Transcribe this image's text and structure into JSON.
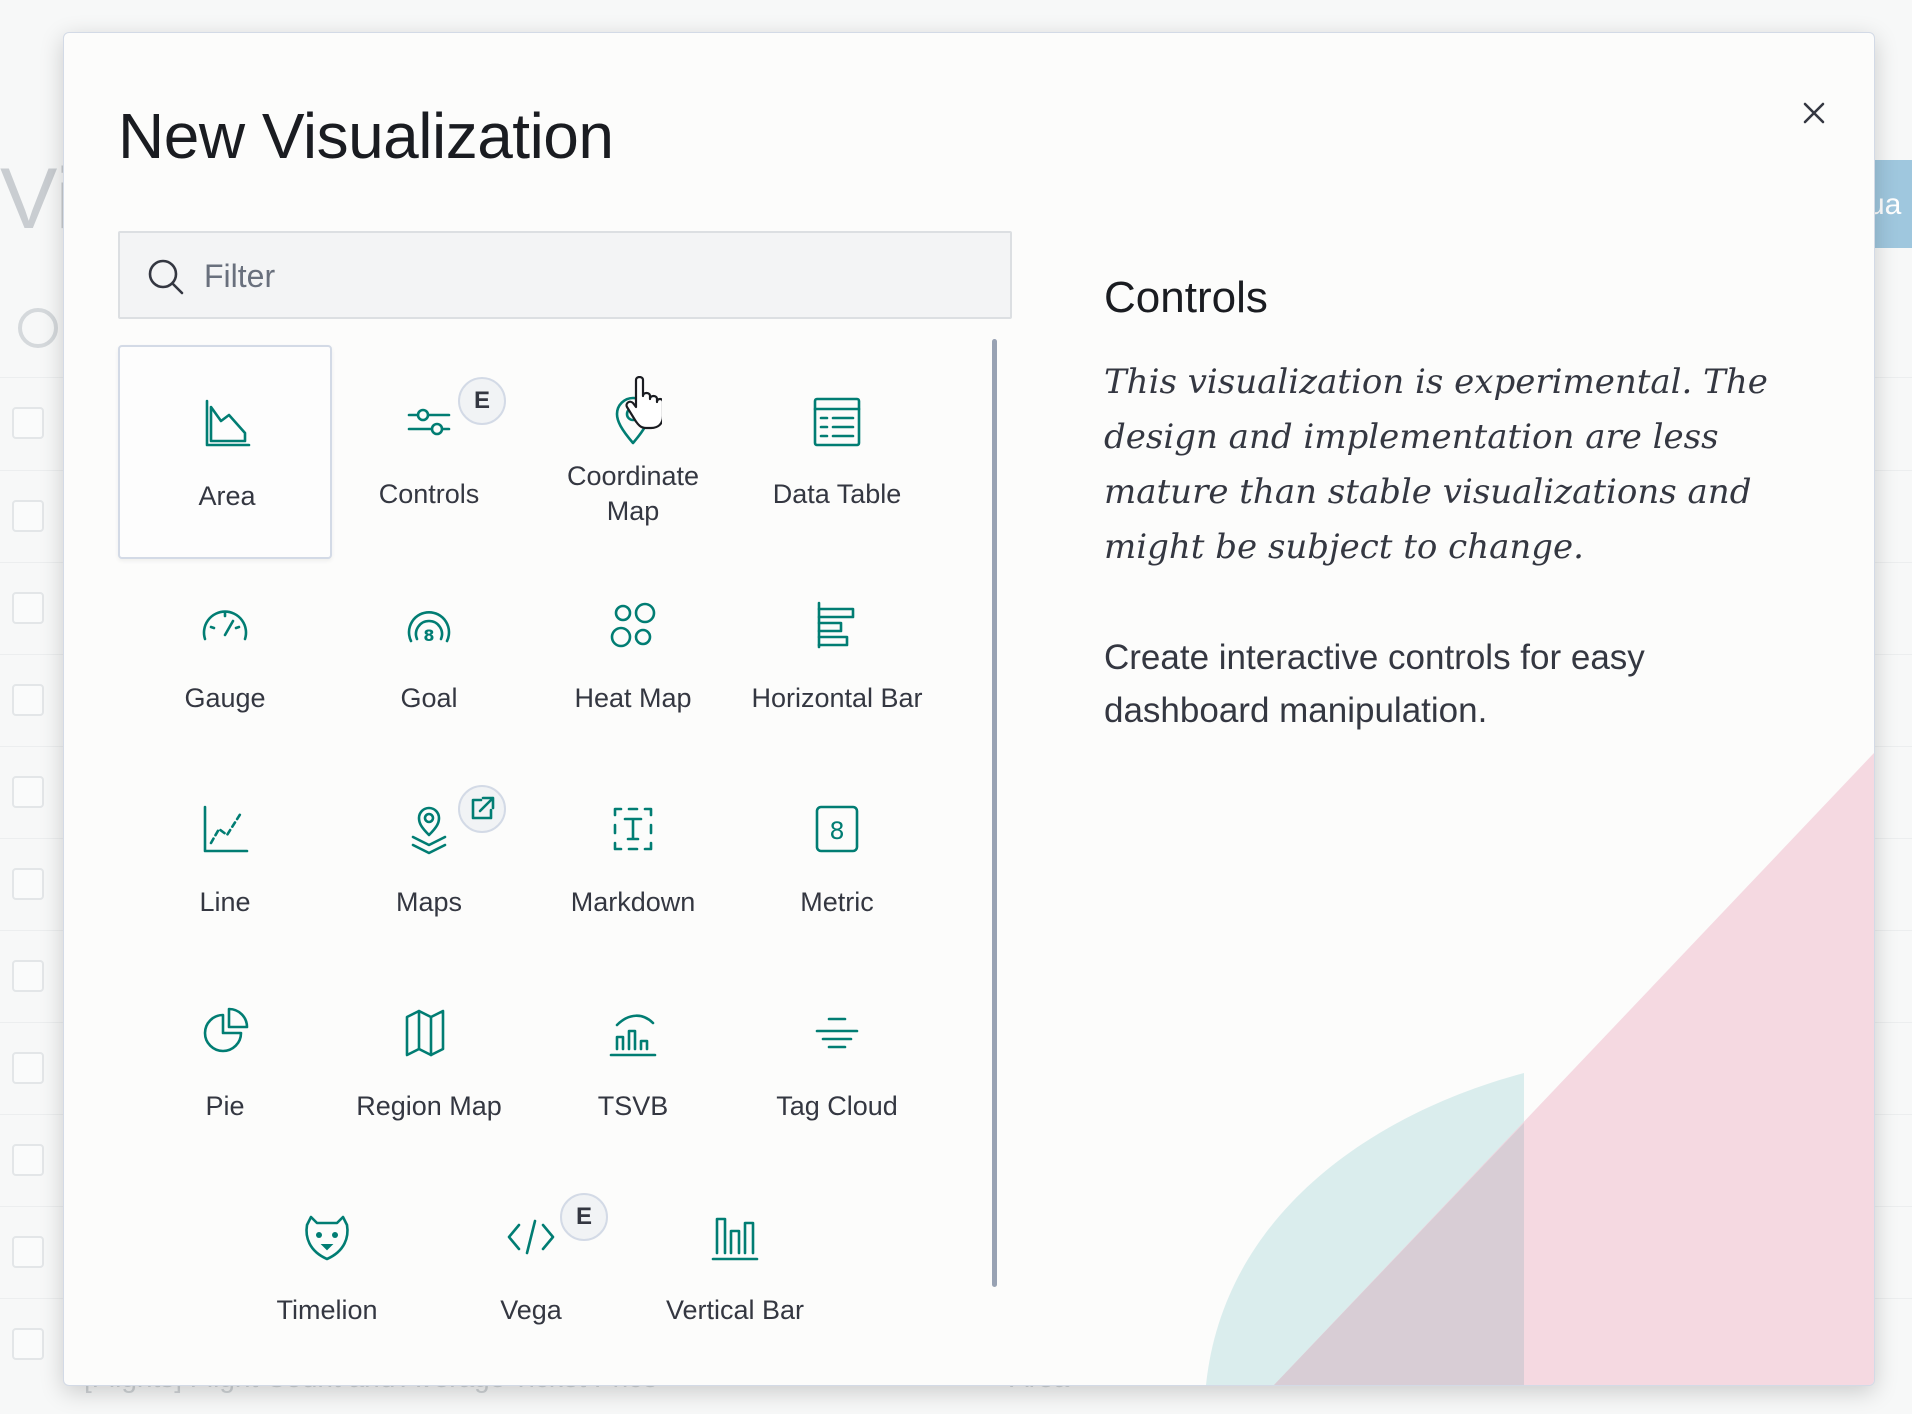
{
  "background": {
    "page_title": "Vi",
    "button_text": "ua",
    "bottom_row_text": "[Flights] Flight Count and Average Ticket Price",
    "bottom_row_type": "Area"
  },
  "modal": {
    "title": "New Visualization",
    "close_label": "×",
    "filter": {
      "placeholder": "Filter",
      "value": ""
    },
    "types": [
      {
        "label": "Area",
        "icon": "area-chart-icon",
        "selected": true
      },
      {
        "label": "Controls",
        "icon": "controls-icon",
        "badge": "E"
      },
      {
        "label": "Coordinate Map",
        "icon": "map-pin-icon"
      },
      {
        "label": "Data Table",
        "icon": "table-icon"
      },
      {
        "label": "Gauge",
        "icon": "gauge-icon"
      },
      {
        "label": "Goal",
        "icon": "goal-icon"
      },
      {
        "label": "Heat Map",
        "icon": "heatmap-icon"
      },
      {
        "label": "Horizontal Bar",
        "icon": "horizontal-bar-icon"
      },
      {
        "label": "Line",
        "icon": "line-chart-icon"
      },
      {
        "label": "Maps",
        "icon": "maps-icon",
        "badge_icon": "external-link-icon"
      },
      {
        "label": "Markdown",
        "icon": "markdown-icon"
      },
      {
        "label": "Metric",
        "icon": "metric-icon"
      },
      {
        "label": "Pie",
        "icon": "pie-chart-icon"
      },
      {
        "label": "Region Map",
        "icon": "region-map-icon"
      },
      {
        "label": "TSVB",
        "icon": "tsvb-icon"
      },
      {
        "label": "Tag Cloud",
        "icon": "tag-cloud-icon"
      },
      {
        "label": "Timelion",
        "icon": "timelion-icon"
      },
      {
        "label": "Vega",
        "icon": "vega-icon",
        "badge": "E"
      },
      {
        "label": "Vertical Bar",
        "icon": "vertical-bar-icon"
      }
    ],
    "details": {
      "title": "Controls",
      "experimental_text": "This visualization is experimental. The design and implementation are less mature than stable visualizations and might be subject to change.",
      "description": "Create interactive controls for easy dashboard manipulation."
    }
  },
  "colors": {
    "accent": "#017d73",
    "text": "#343741",
    "teal_deco": "#d7ecec",
    "pink_deco": "#f4d8e1"
  }
}
